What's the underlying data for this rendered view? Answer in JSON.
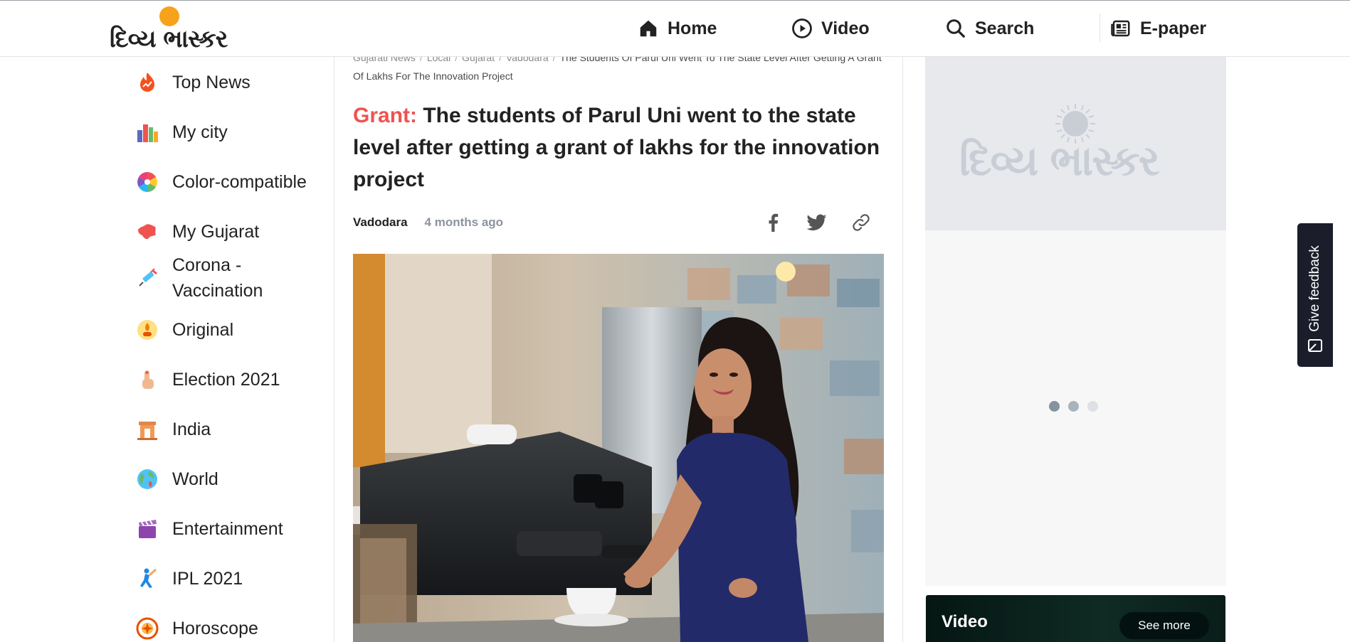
{
  "header": {
    "logo_text": "દિવ્ય ભાસ્કર",
    "nav": {
      "home": "Home",
      "video": "Video",
      "search": "Search",
      "epaper": "E-paper"
    }
  },
  "sidebar": {
    "items": [
      {
        "label": "Top News",
        "icon": "fire-trend-icon"
      },
      {
        "label": "My city",
        "icon": "city-buildings-icon"
      },
      {
        "label": "Color-compatible",
        "icon": "color-wheel-icon"
      },
      {
        "label": "My Gujarat",
        "icon": "gujarat-map-icon"
      },
      {
        "label": "Corona - Vaccination",
        "icon": "syringe-icon"
      },
      {
        "label": "Original",
        "icon": "lamp-icon"
      },
      {
        "label": "Election 2021",
        "icon": "voting-finger-icon"
      },
      {
        "label": "India",
        "icon": "india-gate-icon"
      },
      {
        "label": "World",
        "icon": "globe-icon"
      },
      {
        "label": "Entertainment",
        "icon": "clapperboard-icon"
      },
      {
        "label": "IPL 2021",
        "icon": "cricket-player-icon"
      },
      {
        "label": "Horoscope",
        "icon": "zodiac-wheel-icon"
      }
    ]
  },
  "article": {
    "breadcrumb": [
      "Gujarati News",
      "Local",
      "Gujarat",
      "Vadodara"
    ],
    "breadcrumb_current": "The Students Of Parul Uni Went To The State Level After Getting A Grant Of Lakhs For The Innovation Project",
    "kicker": "Grant:",
    "headline": "The students of Parul Uni went to the state level after getting a grant of lakhs for the innovation project",
    "city": "Vadodara",
    "time_ago": "4 months ago",
    "share": {
      "facebook": "facebook-icon",
      "twitter": "twitter-icon",
      "copy_link": "link-icon"
    }
  },
  "right": {
    "ad_logo_text": "દિવ્ય ભાસ્કર",
    "carousel_dots": 3,
    "carousel_active": 1,
    "video_title": "Video",
    "see_more": "See more"
  },
  "feedback": {
    "label": "Give feedback"
  },
  "colors": {
    "kicker": "#ef5350",
    "logo_sun": "#f7a21b",
    "feedback_bg": "#1b1d2a",
    "video_bg": "#0f2b24"
  }
}
